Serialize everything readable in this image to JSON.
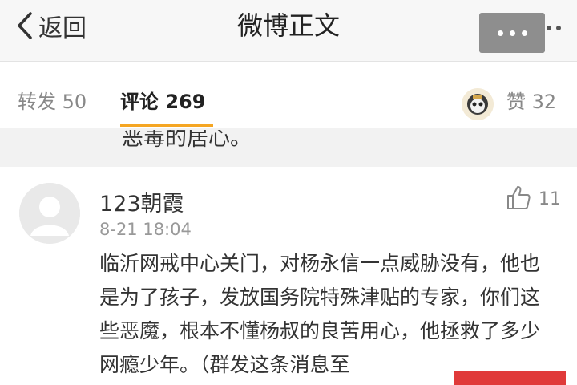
{
  "navbar": {
    "back_label": "返回",
    "title": "微博正文"
  },
  "tabs": {
    "repost_label": "转发 50",
    "comments_label": "评论 269",
    "likes_label": "赞 32"
  },
  "clipped_previous_text": "恶毒的居心。",
  "comment": {
    "username": "123朝霞",
    "timestamp": "8-21 18:04",
    "like_count": "11",
    "body": "临沂网戒中心关门，对杨永信一点威胁没有，他也是为了孩子，发放国务院特殊津贴的专家，你们这些恶魔，根本不懂杨叔的良苦用心，他拯救了多少网瘾少年。（群发这条消息至"
  },
  "colors": {
    "accent": "#f5a623",
    "navbar_bg": "#f7f7f7",
    "more_button_bg": "#8e8e8e"
  },
  "icons": [
    "chevron-left-icon",
    "more-dots-icon",
    "thumbs-up-icon",
    "avatar-placeholder-icon"
  ]
}
